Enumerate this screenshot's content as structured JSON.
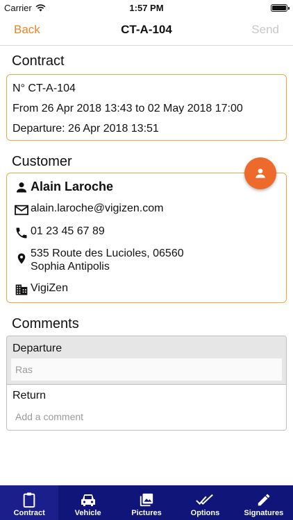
{
  "status_bar": {
    "carrier": "Carrier",
    "time": "1:57 PM"
  },
  "nav": {
    "back": "Back",
    "title": "CT-A-104",
    "send": "Send"
  },
  "contract": {
    "section_title": "Contract",
    "number": "N° CT-A-104",
    "period": "From 26 Apr 2018 13:43 to 02 May 2018 17:00",
    "departure": "Departure: 26 Apr 2018 13:51"
  },
  "customer": {
    "section_title": "Customer",
    "name": "Alain Laroche",
    "email": "alain.laroche@vigizen.com",
    "phone": "01 23 45 67 89",
    "address_line1": "535 Route des Lucioles, 06560",
    "address_line2": "Sophia Antipolis",
    "company": "VigiZen"
  },
  "comments": {
    "section_title": "Comments",
    "departure_label": "Departure",
    "departure_value": "Ras",
    "return_label": "Return",
    "return_placeholder": "Add a comment"
  },
  "tabs": [
    {
      "label": "Contract",
      "icon": "clipboard-icon",
      "active": true
    },
    {
      "label": "Vehicle",
      "icon": "car-icon",
      "active": false
    },
    {
      "label": "Pictures",
      "icon": "photos-icon",
      "active": false
    },
    {
      "label": "Options",
      "icon": "double-check-icon",
      "active": false
    },
    {
      "label": "Signatures",
      "icon": "pen-icon",
      "active": false
    }
  ],
  "colors": {
    "accent": "#e8832a",
    "card_border": "#f0a540",
    "fab": "#ee6a2a",
    "tab_bar": "#10157a"
  }
}
